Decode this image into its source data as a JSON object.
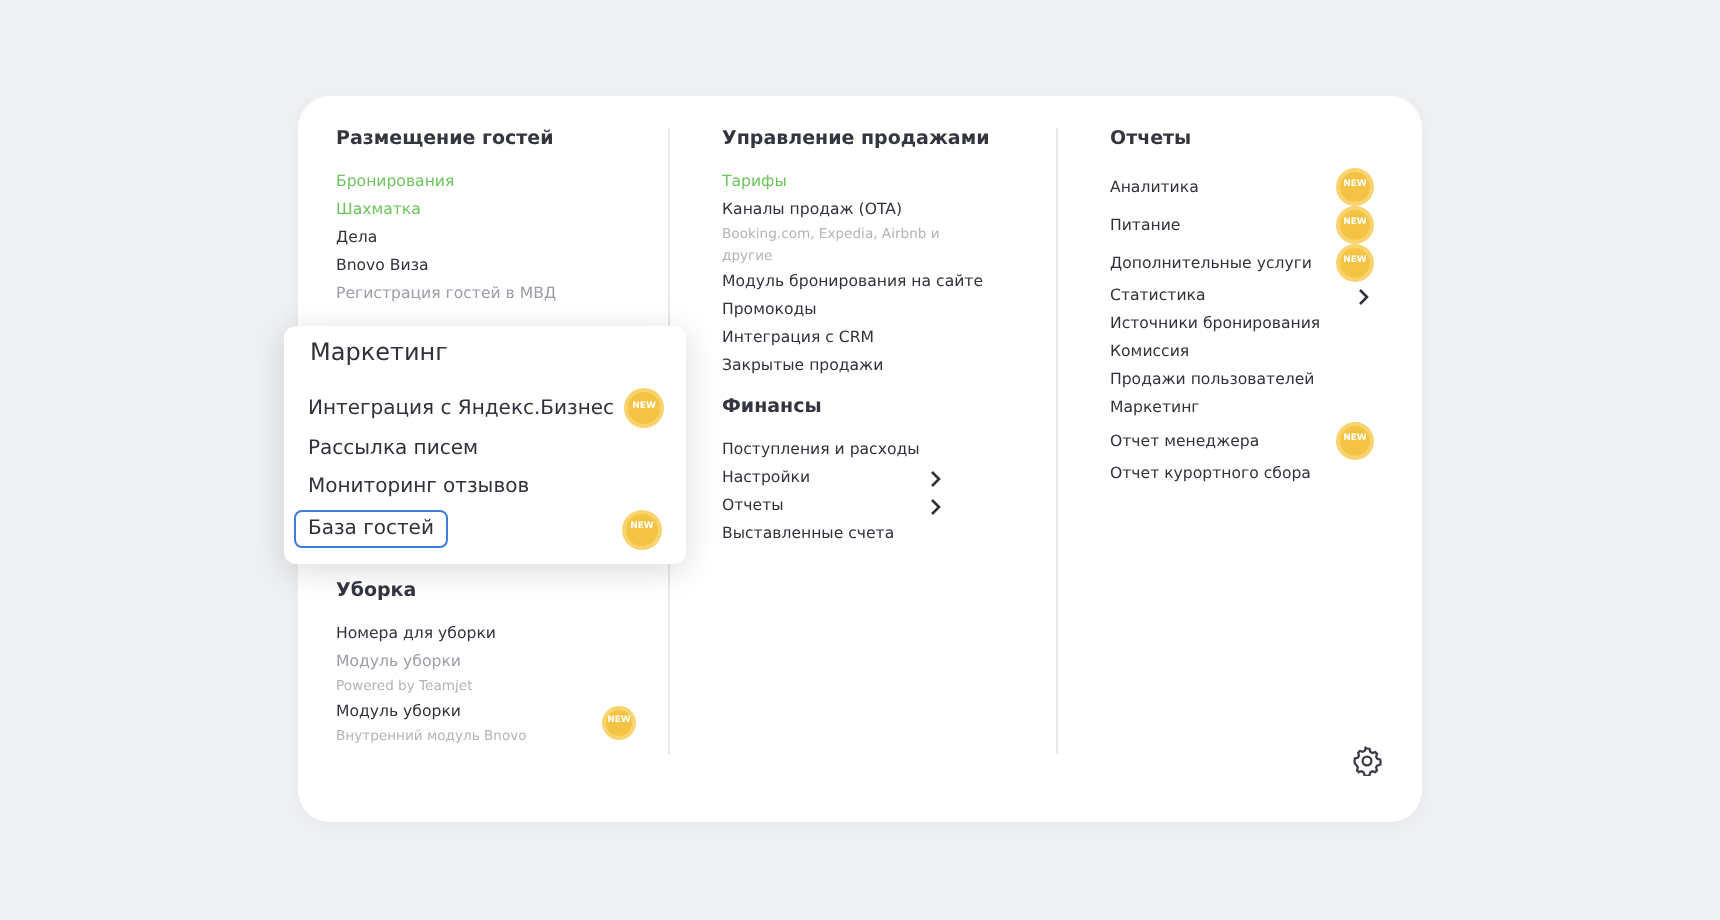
{
  "columns": [
    {
      "sections": [
        {
          "title": "Размещение гостей",
          "items": [
            {
              "label": "Бронирования",
              "highlighted": true,
              "disabled": false,
              "new": false,
              "submenu": false
            },
            {
              "label": "Шахматка",
              "highlighted": true,
              "disabled": false,
              "new": false,
              "submenu": false
            },
            {
              "label": "Дела",
              "highlighted": false,
              "disabled": false,
              "new": false,
              "submenu": false
            },
            {
              "label": "Bnovo Виза",
              "highlighted": false,
              "disabled": false,
              "new": false,
              "submenu": false
            },
            {
              "label": "Регистрация гостей в МВД",
              "highlighted": false,
              "disabled": true,
              "new": false,
              "submenu": false
            }
          ]
        },
        {
          "title": "Уборка",
          "items": [
            {
              "label": "Номера для уборки",
              "highlighted": false,
              "disabled": false,
              "new": false,
              "submenu": false
            },
            {
              "label": "Модуль уборки",
              "subtitle": "Powered by Teamjet",
              "highlighted": false,
              "disabled": true,
              "new": false,
              "submenu": false
            },
            {
              "label": "Модуль уборки",
              "subtitle": "Внутренний модуль Bnovo",
              "highlighted": false,
              "disabled": false,
              "new": true,
              "badge": "NEW",
              "submenu": false
            }
          ]
        }
      ]
    },
    {
      "sections": [
        {
          "title": "Управление продажами",
          "items": [
            {
              "label": "Тарифы",
              "highlighted": true,
              "disabled": false,
              "new": false,
              "submenu": false
            },
            {
              "label": "Каналы продаж (OTA)",
              "subtitle": "Booking.com, Expedia, Airbnb и другие",
              "highlighted": false,
              "disabled": false,
              "new": false,
              "submenu": false
            },
            {
              "label": "Модуль бронирования на сайте",
              "highlighted": false,
              "disabled": false,
              "new": false,
              "submenu": false
            },
            {
              "label": "Промокоды",
              "highlighted": false,
              "disabled": false,
              "new": false,
              "submenu": false
            },
            {
              "label": "Интеграция с CRM",
              "highlighted": false,
              "disabled": false,
              "new": false,
              "submenu": false
            },
            {
              "label": "Закрытые продажи",
              "highlighted": false,
              "disabled": false,
              "new": false,
              "submenu": false
            }
          ]
        },
        {
          "title": "Финансы",
          "items": [
            {
              "label": "Поступления и расходы",
              "highlighted": false,
              "disabled": false,
              "new": false,
              "submenu": false
            },
            {
              "label": "Настройки",
              "highlighted": false,
              "disabled": false,
              "new": false,
              "submenu": true
            },
            {
              "label": "Отчеты",
              "highlighted": false,
              "disabled": false,
              "new": false,
              "submenu": true
            },
            {
              "label": "Выставленные счета",
              "highlighted": false,
              "disabled": false,
              "new": false,
              "submenu": false
            }
          ]
        }
      ]
    },
    {
      "sections": [
        {
          "title": "Отчеты",
          "items": [
            {
              "label": "Аналитика",
              "highlighted": false,
              "disabled": false,
              "new": true,
              "badge": "NEW",
              "submenu": false
            },
            {
              "label": "Питание",
              "highlighted": false,
              "disabled": false,
              "new": true,
              "badge": "NEW",
              "submenu": false
            },
            {
              "label": "Дополнительные услуги",
              "highlighted": false,
              "disabled": false,
              "new": true,
              "badge": "NEW",
              "submenu": false
            },
            {
              "label": "Статистика",
              "highlighted": false,
              "disabled": false,
              "new": false,
              "submenu": true
            },
            {
              "label": "Источники бронирования",
              "highlighted": false,
              "disabled": false,
              "new": false,
              "submenu": false
            },
            {
              "label": "Комиссия",
              "highlighted": false,
              "disabled": false,
              "new": false,
              "submenu": false
            },
            {
              "label": "Продажи пользователей",
              "highlighted": false,
              "disabled": false,
              "new": false,
              "submenu": false
            },
            {
              "label": "Маркетинг",
              "highlighted": false,
              "disabled": false,
              "new": false,
              "submenu": false
            },
            {
              "label": "Отчет менеджера",
              "highlighted": false,
              "disabled": false,
              "new": true,
              "badge": "NEW",
              "submenu": false
            },
            {
              "label": "Отчет курортного сбора",
              "highlighted": false,
              "disabled": false,
              "new": false,
              "submenu": false
            }
          ]
        }
      ]
    }
  ],
  "popup": {
    "title": "Маркетинг",
    "items": [
      {
        "label": "Интеграция с Яндекс.Бизнес",
        "selected": false,
        "new": true,
        "badge": "NEW"
      },
      {
        "label": "Рассылка писем",
        "selected": false,
        "new": false
      },
      {
        "label": "Мониторинг отзывов",
        "selected": false,
        "new": false
      },
      {
        "label": "База гостей",
        "selected": true,
        "new": true,
        "badge": "NEW"
      }
    ]
  }
}
